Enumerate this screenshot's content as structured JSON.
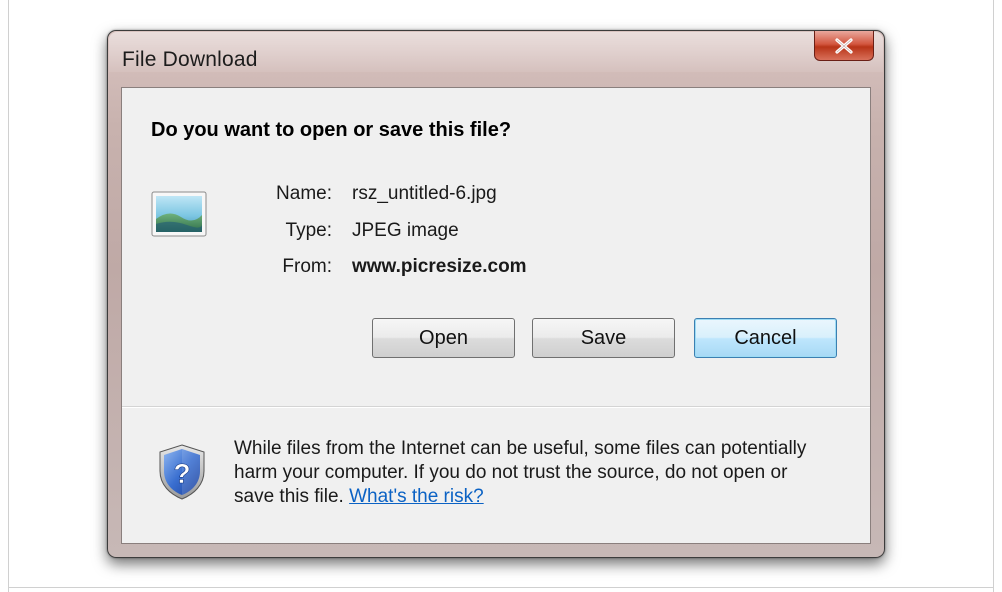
{
  "window": {
    "title": "File Download",
    "close_icon": "close-x-icon"
  },
  "dialog": {
    "question": "Do you want to open or save this file?",
    "file_icon": "jpeg-image-file-icon",
    "fields": {
      "name_label": "Name:",
      "name_value": "rsz_untitled-6.jpg",
      "type_label": "Type:",
      "type_value": "JPEG image",
      "from_label": "From:",
      "from_value": "www.picresize.com"
    },
    "buttons": {
      "open": "Open",
      "save": "Save",
      "cancel": "Cancel"
    },
    "warning": {
      "icon": "security-shield-question-icon",
      "line1": "While files from the Internet can be useful, some files can potentially",
      "line2": "harm your computer. If you do not trust the source, do not open or",
      "line3_prefix": "save this file.",
      "link": "What's the risk?"
    }
  },
  "colors": {
    "link": "#0b62c4",
    "close_button": "#c94a33",
    "default_button_border": "#3c7fb1"
  }
}
